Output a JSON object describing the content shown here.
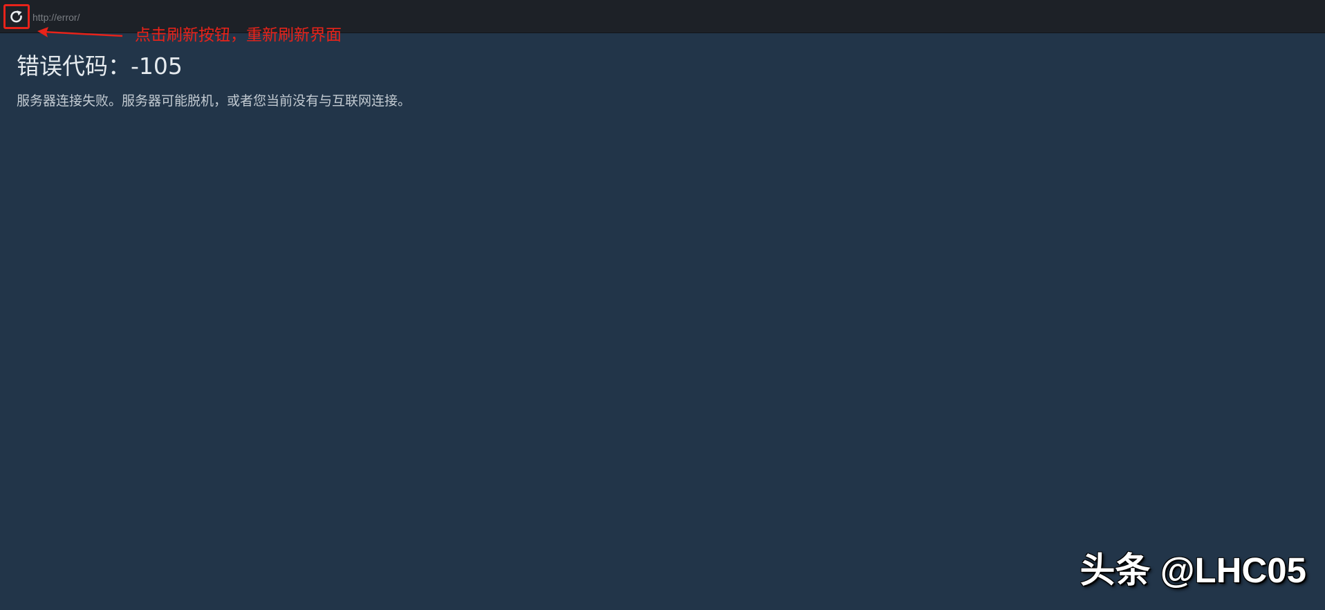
{
  "browser": {
    "url": "http://error/",
    "refresh_icon": "refresh-icon"
  },
  "annotation": {
    "text": "点击刷新按钮，重新刷新界面",
    "color": "#e8231a"
  },
  "error": {
    "title": "错误代码：-105",
    "description": "服务器连接失败。服务器可能脱机，或者您当前没有与互联网连接。"
  },
  "watermark": {
    "text": "头条 @LHC05"
  },
  "colors": {
    "background": "#223549",
    "topbar": "#1d2127",
    "highlight": "#e8231a"
  }
}
